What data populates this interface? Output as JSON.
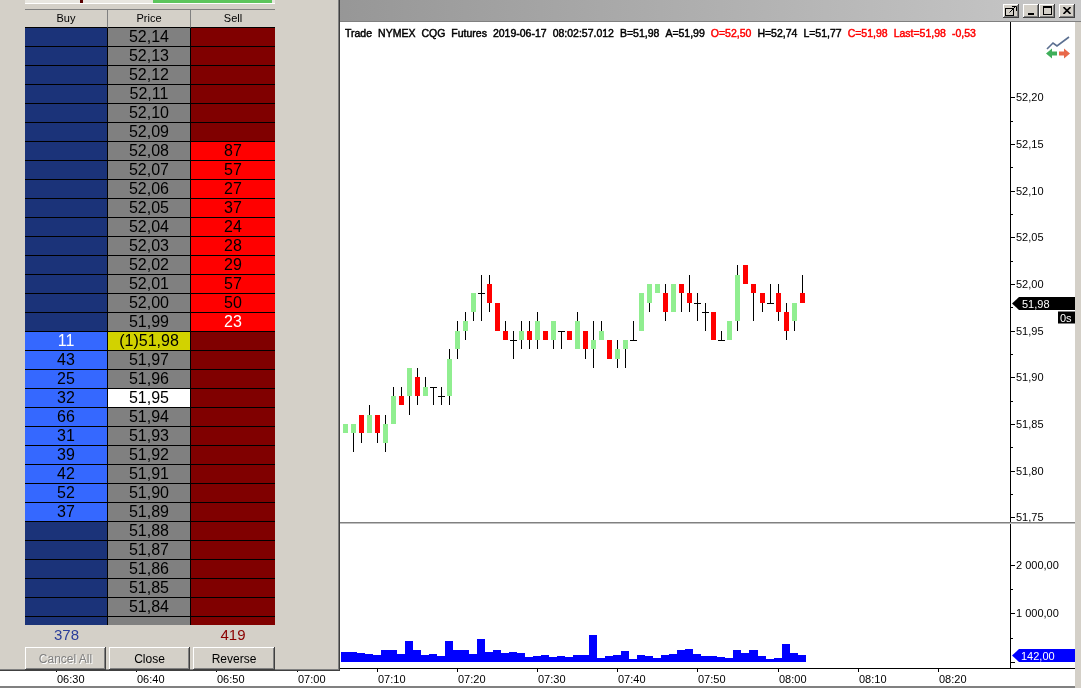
{
  "ladder": {
    "columns": [
      "Buy",
      "Price",
      "Sell"
    ],
    "rows": [
      {
        "price": "52,14",
        "last": false,
        "selected": false
      },
      {
        "price": "52,13",
        "last": false,
        "selected": false
      },
      {
        "price": "52,12",
        "last": false,
        "selected": false
      },
      {
        "price": "52,11",
        "last": false,
        "selected": false
      },
      {
        "price": "52,10",
        "last": false,
        "selected": false
      },
      {
        "price": "52,09",
        "last": false,
        "selected": false
      },
      {
        "price": "52,08",
        "sell": "87",
        "last": false,
        "selected": false
      },
      {
        "price": "52,07",
        "sell": "57",
        "last": false,
        "selected": false
      },
      {
        "price": "52,06",
        "sell": "27",
        "last": false,
        "selected": false
      },
      {
        "price": "52,05",
        "sell": "37",
        "last": false,
        "selected": false
      },
      {
        "price": "52,04",
        "sell": "24",
        "last": false,
        "selected": false
      },
      {
        "price": "52,03",
        "sell": "28",
        "last": false,
        "selected": false
      },
      {
        "price": "52,02",
        "sell": "29",
        "last": false,
        "selected": false
      },
      {
        "price": "52,01",
        "sell": "57",
        "last": false,
        "selected": false
      },
      {
        "price": "52,00",
        "sell": "50",
        "last": false,
        "selected": false
      },
      {
        "price": "51,99",
        "sell": "23",
        "last": false,
        "selected": false
      },
      {
        "buy": "11",
        "price": "(1)51,98",
        "last": true,
        "selected": false
      },
      {
        "buy": "43",
        "price": "51,97",
        "last": false,
        "selected": false
      },
      {
        "buy": "25",
        "price": "51,96",
        "last": false,
        "selected": false
      },
      {
        "buy": "32",
        "price": "51,95",
        "last": false,
        "selected": true
      },
      {
        "buy": "66",
        "price": "51,94",
        "last": false,
        "selected": false
      },
      {
        "buy": "31",
        "price": "51,93",
        "last": false,
        "selected": false
      },
      {
        "buy": "39",
        "price": "51,92",
        "last": false,
        "selected": false
      },
      {
        "buy": "42",
        "price": "51,91",
        "last": false,
        "selected": false
      },
      {
        "buy": "52",
        "price": "51,90",
        "last": false,
        "selected": false
      },
      {
        "buy": "37",
        "price": "51,89",
        "last": false,
        "selected": false
      },
      {
        "price": "51,88",
        "last": false,
        "selected": false
      },
      {
        "price": "51,87",
        "last": false,
        "selected": false
      },
      {
        "price": "51,86",
        "last": false,
        "selected": false
      },
      {
        "price": "51,85",
        "last": false,
        "selected": false
      },
      {
        "price": "51,84",
        "last": false,
        "selected": false
      }
    ],
    "totals": {
      "buy": "378",
      "sell": "419"
    },
    "buttons": [
      {
        "label": "Cancel All",
        "disabled": true
      },
      {
        "label": "Close",
        "disabled": false
      },
      {
        "label": "Reverse",
        "disabled": false
      }
    ]
  },
  "chart": {
    "header": [
      {
        "text": "Trade",
        "color": "#000000"
      },
      {
        "text": "NYMEX",
        "color": "#000000"
      },
      {
        "text": "CQG",
        "color": "#000000"
      },
      {
        "text": "Futures",
        "color": "#000000"
      },
      {
        "text": "2019-06-17",
        "color": "#000000"
      },
      {
        "text": "08:02:57.012",
        "color": "#000000"
      },
      {
        "text": "B=51,98",
        "color": "#000000"
      },
      {
        "text": "A=51,99",
        "color": "#000000"
      },
      {
        "text": "O=52,50",
        "color": "#ff0000"
      },
      {
        "text": "H=52,74",
        "color": "#000000"
      },
      {
        "text": "L=51,77",
        "color": "#000000"
      },
      {
        "text": "C=51,98",
        "color": "#ff0000"
      },
      {
        "text": "Last=51,98",
        "color": "#ff0000"
      },
      {
        "text": "-0,53",
        "color": "#ff0000"
      }
    ],
    "price_pane": {
      "axis_labels": [
        "52,20",
        "52,15",
        "52,10",
        "52,05",
        "52,00",
        "51,95",
        "51,90",
        "51,85",
        "51,80",
        "51,75"
      ],
      "last_price_tag": "51,98",
      "timer_tag": "0s"
    },
    "volume_pane": {
      "axis_labels": [
        "2 000,00",
        "1 000,00"
      ],
      "last_volume_tag": "142,00"
    },
    "time_axis": [
      "06:30",
      "06:40",
      "06:50",
      "07:00",
      "07:10",
      "07:20",
      "07:30",
      "07:40",
      "07:50",
      "08:00",
      "08:10",
      "08:20"
    ]
  }
}
